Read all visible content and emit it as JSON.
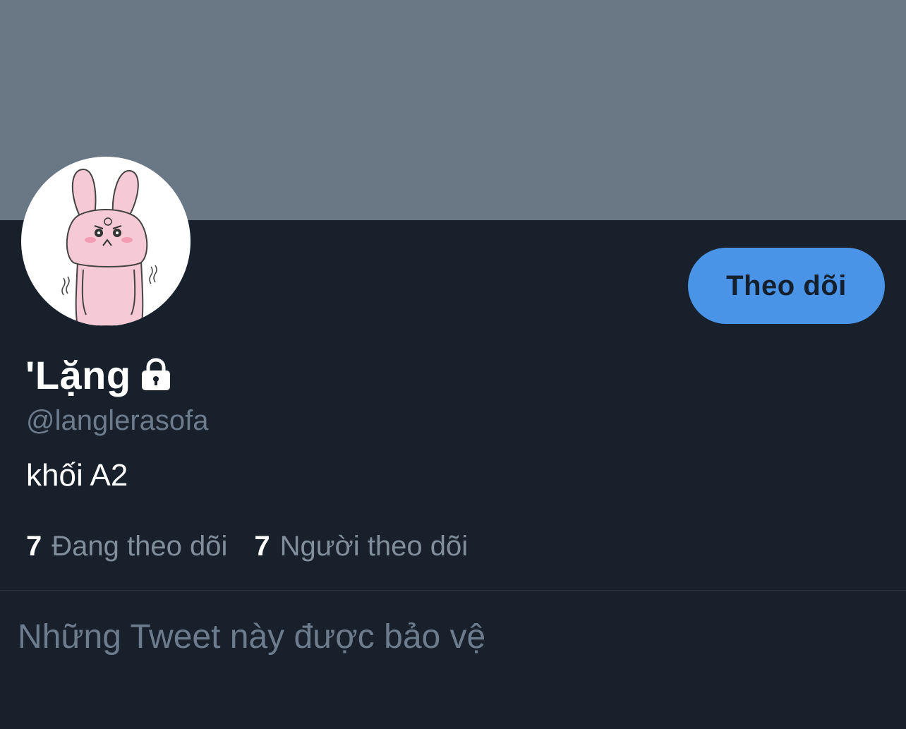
{
  "profile": {
    "display_name": "'Lặng",
    "handle": "@langlerasofa",
    "bio": "khối A2",
    "follow_button_label": "Theo dõi",
    "avatar_icon": "pink-bunny-avatar",
    "lock_icon": "lock-icon"
  },
  "stats": {
    "following_count": "7",
    "following_label": "Đang theo dõi",
    "followers_count": "7",
    "followers_label": "Người theo dõi"
  },
  "tweets": {
    "protected_message": "Những Tweet này được bảo vệ"
  },
  "colors": {
    "background": "#17202b",
    "banner": "#6a7886",
    "accent": "#4a94e8",
    "muted_text": "#6d7c8c"
  }
}
